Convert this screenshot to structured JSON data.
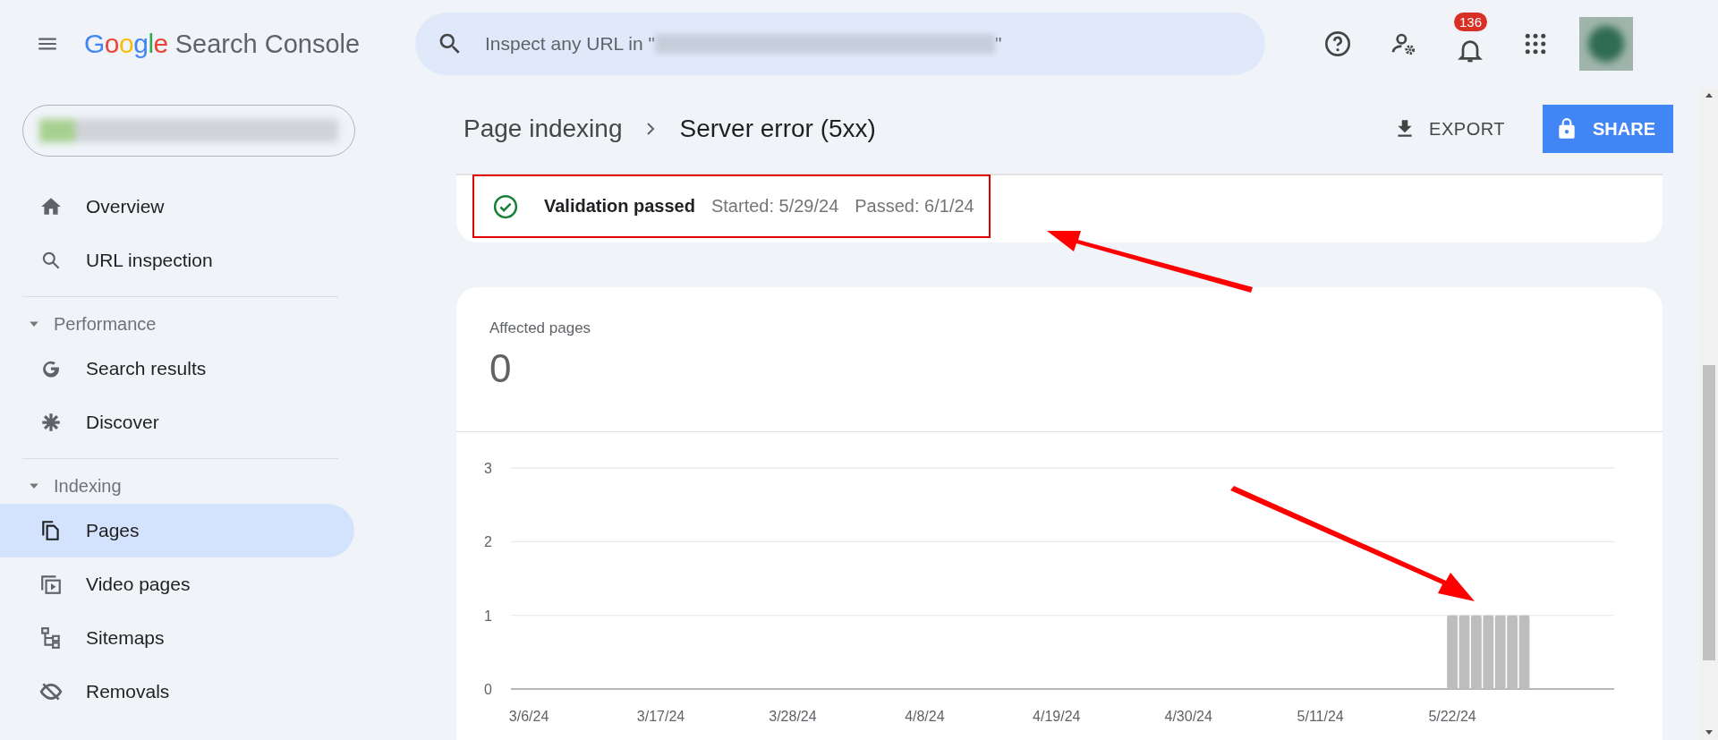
{
  "header": {
    "logo_brand": "Google",
    "logo_product": "Search Console",
    "search": {
      "prefix": "Inspect any URL in \"",
      "suffix": "\""
    },
    "notifications_badge": "136"
  },
  "sidebar": {
    "groups": [
      {
        "items": [
          {
            "label": "Overview",
            "selected": false
          },
          {
            "label": "URL inspection",
            "selected": false
          }
        ]
      },
      {
        "title": "Performance",
        "expanded": true,
        "items": [
          {
            "label": "Search results",
            "selected": false
          },
          {
            "label": "Discover",
            "selected": false
          }
        ]
      },
      {
        "title": "Indexing",
        "expanded": true,
        "items": [
          {
            "label": "Pages",
            "selected": true
          },
          {
            "label": "Video pages",
            "selected": false
          },
          {
            "label": "Sitemaps",
            "selected": false
          },
          {
            "label": "Removals",
            "selected": false
          }
        ]
      }
    ]
  },
  "breadcrumb": {
    "parent": "Page indexing",
    "current": "Server error (5xx)"
  },
  "actions": {
    "export": "EXPORT",
    "share": "SHARE"
  },
  "validation": {
    "status": "Validation passed",
    "started": "Started: 5/29/24",
    "passed": "Passed: 6/1/24"
  },
  "affected": {
    "label": "Affected pages",
    "count": "0",
    "chart_data": {
      "type": "bar",
      "ylim": [
        0,
        3
      ],
      "yticks": [
        0,
        1,
        2,
        3
      ],
      "categories": [
        null,
        "3/6/24",
        null,
        null,
        null,
        null,
        null,
        null,
        null,
        null,
        null,
        null,
        "3/17/24",
        null,
        null,
        null,
        null,
        null,
        null,
        null,
        null,
        null,
        null,
        "3/28/24",
        null,
        null,
        null,
        null,
        null,
        null,
        null,
        null,
        null,
        null,
        "4/8/24",
        null,
        null,
        null,
        null,
        null,
        null,
        null,
        null,
        null,
        null,
        "4/19/24",
        null,
        null,
        null,
        null,
        null,
        null,
        null,
        null,
        null,
        null,
        "4/30/24",
        null,
        null,
        null,
        null,
        null,
        null,
        null,
        null,
        null,
        null,
        "5/11/24",
        null,
        null,
        null,
        null,
        null,
        null,
        null,
        null,
        null,
        null,
        "5/22/24",
        null,
        null,
        null,
        null,
        null,
        null,
        null,
        null,
        null,
        null,
        null,
        null,
        null
      ],
      "values": [
        null,
        null,
        null,
        null,
        null,
        null,
        null,
        null,
        null,
        null,
        null,
        null,
        null,
        null,
        null,
        null,
        null,
        null,
        null,
        null,
        null,
        null,
        null,
        null,
        null,
        null,
        null,
        null,
        null,
        null,
        null,
        null,
        null,
        null,
        null,
        null,
        null,
        null,
        null,
        null,
        null,
        null,
        null,
        null,
        null,
        null,
        null,
        null,
        null,
        null,
        null,
        null,
        null,
        null,
        null,
        null,
        null,
        null,
        null,
        null,
        null,
        null,
        null,
        null,
        null,
        null,
        null,
        null,
        null,
        null,
        null,
        null,
        null,
        null,
        null,
        null,
        null,
        null,
        1,
        1,
        1,
        1,
        1,
        1,
        1,
        null,
        null,
        null,
        null,
        null,
        null,
        null
      ]
    }
  }
}
